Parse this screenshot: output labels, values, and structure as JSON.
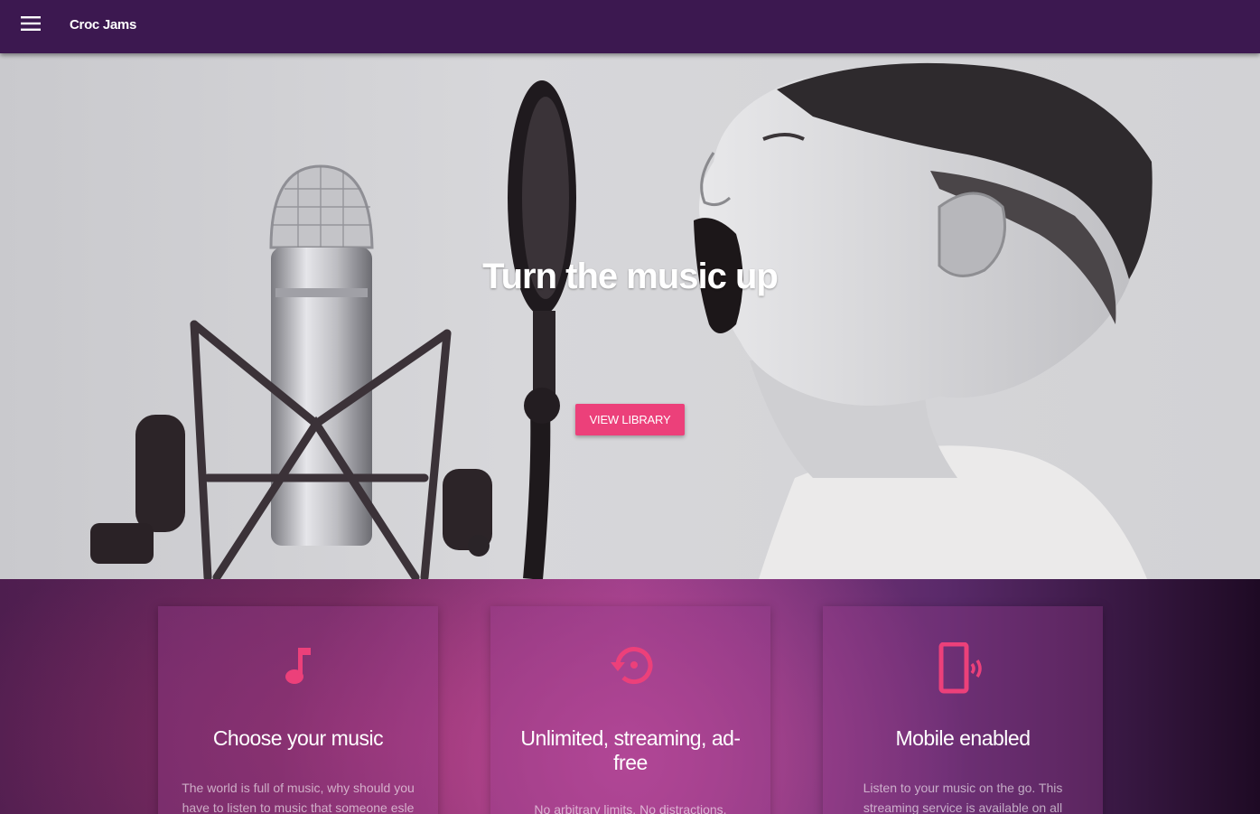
{
  "header": {
    "menu_icon": "hamburger-menu-icon",
    "app_title": "Croc Jams"
  },
  "hero": {
    "title": "Turn the music up",
    "cta_label": "VIEW LIBRARY",
    "image": "black-and-white photo of a boy singing into a studio microphone with a pop filter"
  },
  "features": [
    {
      "icon": "music-note-icon",
      "title": "Choose your music",
      "text": "The world is full of music, why should you have to listen to music that someone esle"
    },
    {
      "icon": "restore-icon",
      "title": "Unlimited, streaming, ad-free",
      "text": "No arbitrary limits. No distractions."
    },
    {
      "icon": "mobile-vibrate-icon",
      "title": "Mobile enabled",
      "text": "Listen to your music on the go. This streaming service is available on all mobile platforms."
    }
  ],
  "colors": {
    "header_bg": "#3c1850",
    "accent": "#ec407a",
    "hero_text": "#ffffff"
  }
}
